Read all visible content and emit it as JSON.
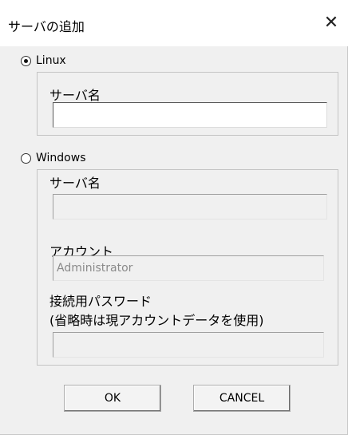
{
  "window": {
    "title": "サーバの追加",
    "close_glyph": "✕"
  },
  "linux": {
    "radio_label": "Linux",
    "checked": true,
    "server_name_label": "サーバ名",
    "server_name_value": ""
  },
  "windows": {
    "radio_label": "Windows",
    "checked": false,
    "server_name_label": "サーバ名",
    "server_name_value": "",
    "account_label": "アカウント",
    "account_value": "Administrator",
    "password_label": "接続用パスワード",
    "password_note": "(省略時は現アカウントデータを使用)",
    "password_value": ""
  },
  "buttons": {
    "ok_label": "OK",
    "cancel_label": "CANCEL"
  }
}
